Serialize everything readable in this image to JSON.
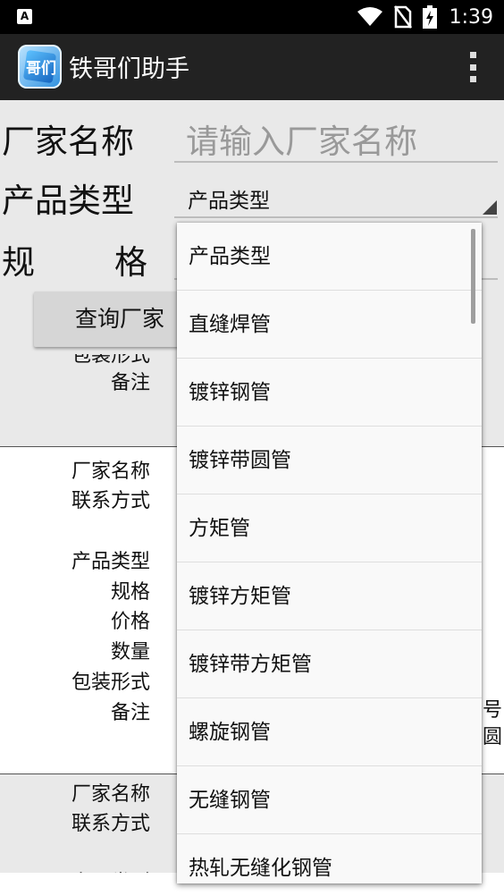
{
  "status": {
    "time": "1:39",
    "app_icon_letter": "A"
  },
  "app": {
    "title": "铁哥们助手",
    "logo_glyph": "哥们"
  },
  "form": {
    "vendor_label": "厂家名称",
    "vendor_placeholder": "请输入厂家名称",
    "type_label": "产品类型",
    "type_selected": "产品类型",
    "spec_label_1": "规",
    "spec_label_2": "格",
    "query_button": "查询厂家"
  },
  "records": {
    "top_partial": {
      "pack": "包装形式",
      "remark": "备注"
    },
    "full": {
      "vendor": "厂家名称",
      "contact": "联系方式",
      "type": "产品类型",
      "spec": "规格",
      "price": "价格",
      "qty": "数量",
      "pack": "包装形式",
      "remark": "备注",
      "side_1": "号",
      "side_2": "圆"
    },
    "bottom_partial": {
      "vendor": "厂家名称",
      "contact": "联系方式",
      "type": "产品类型"
    }
  },
  "dropdown": {
    "items": [
      "产品类型",
      "直缝焊管",
      "镀锌钢管",
      "镀锌带圆管",
      "方矩管",
      "镀锌方矩管",
      "镀锌带方矩管",
      "螺旋钢管",
      "无缝钢管",
      "热轧无缝化钢管"
    ]
  }
}
